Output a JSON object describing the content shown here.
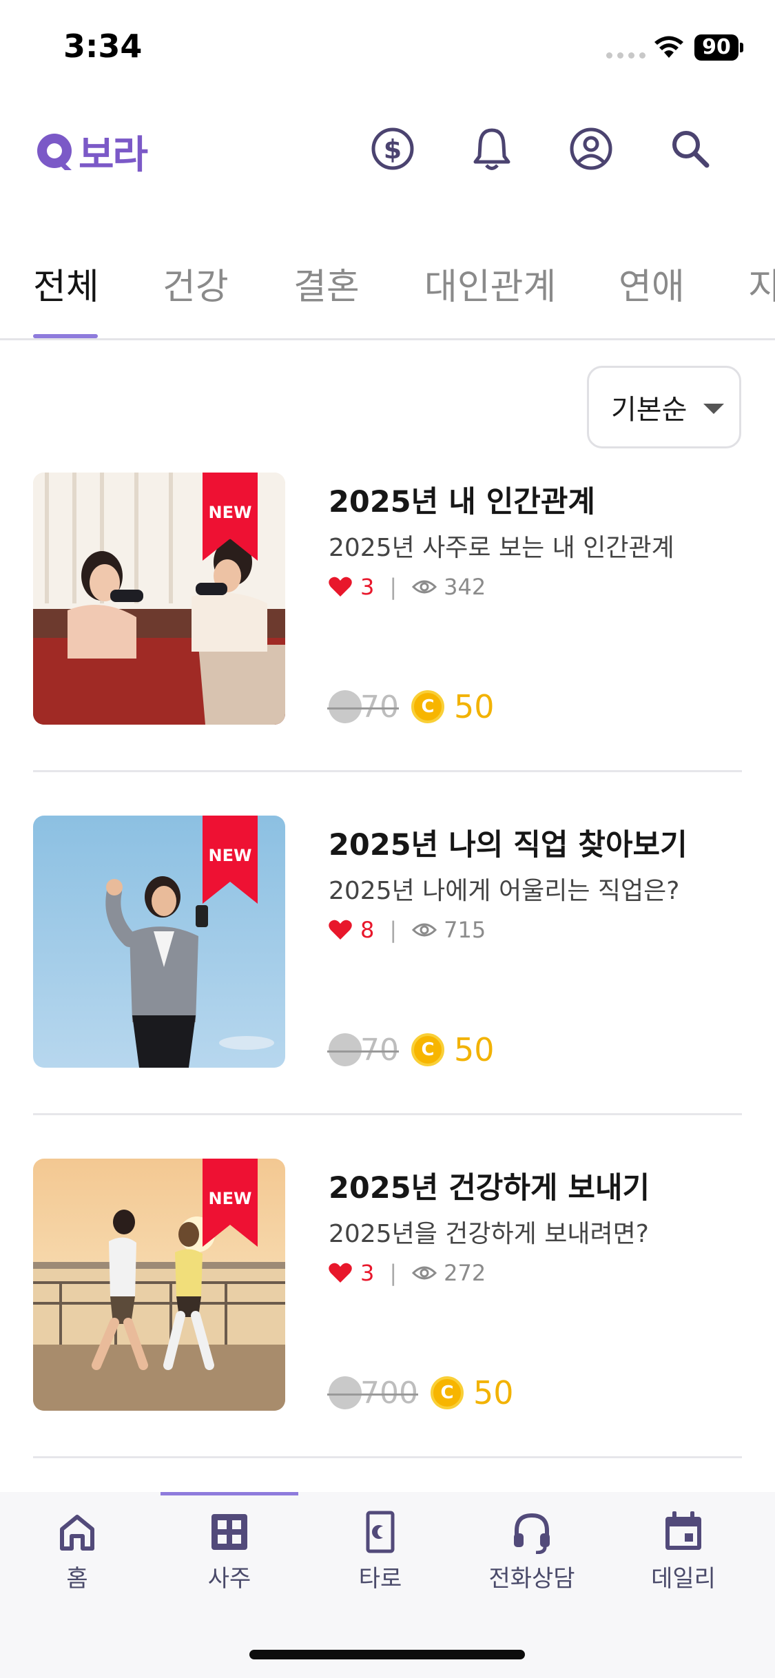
{
  "status_bar": {
    "time": "3:34",
    "battery": "90"
  },
  "header": {
    "logo_text": "보라",
    "icons": [
      "coin-dollar-icon",
      "bell-icon",
      "profile-icon",
      "search-icon"
    ]
  },
  "tabs": [
    {
      "label": "전체",
      "active": true
    },
    {
      "label": "건강"
    },
    {
      "label": "결혼"
    },
    {
      "label": "대인관계"
    },
    {
      "label": "연애"
    },
    {
      "label": "지"
    }
  ],
  "sort": {
    "label": "기본순"
  },
  "items": [
    {
      "badge": "NEW",
      "title": "2025년 내 인간관계",
      "subtitle": "2025년 사주로 보는 내 인간관계",
      "likes": "3",
      "views": "342",
      "old_price": "70",
      "coin_letter": "C",
      "new_price": "50",
      "image": "two-women-playing-video-games"
    },
    {
      "badge": "NEW",
      "title": "2025년 나의 직업 찾아보기",
      "subtitle": "2025년 나에게 어울리는 직업은?",
      "likes": "8",
      "views": "715",
      "old_price": "70",
      "coin_letter": "C",
      "new_price": "50",
      "image": "businesswoman-celebrating-with-phone"
    },
    {
      "badge": "NEW",
      "title": "2025년 건강하게 보내기",
      "subtitle": "2025년을 건강하게 보내려면?",
      "likes": "3",
      "views": "272",
      "old_price": "700",
      "coin_letter": "C",
      "new_price": "50",
      "image": "couple-jogging-at-sunset"
    }
  ],
  "bottom_nav": [
    {
      "label": "홈",
      "icon": "home-icon"
    },
    {
      "label": "사주",
      "icon": "grid-icon",
      "active": true
    },
    {
      "label": "타로",
      "icon": "tarot-card-icon"
    },
    {
      "label": "전화상담",
      "icon": "headset-icon"
    },
    {
      "label": "데일리",
      "icon": "calendar-icon"
    }
  ],
  "colors": {
    "brand_purple": "#7b59c7",
    "tab_underline": "#8e7bdc",
    "heart_red": "#e8172b",
    "badge_red": "#ee1133",
    "coin_gold": "#f7b500",
    "nav_ink": "#4a4a6a"
  }
}
